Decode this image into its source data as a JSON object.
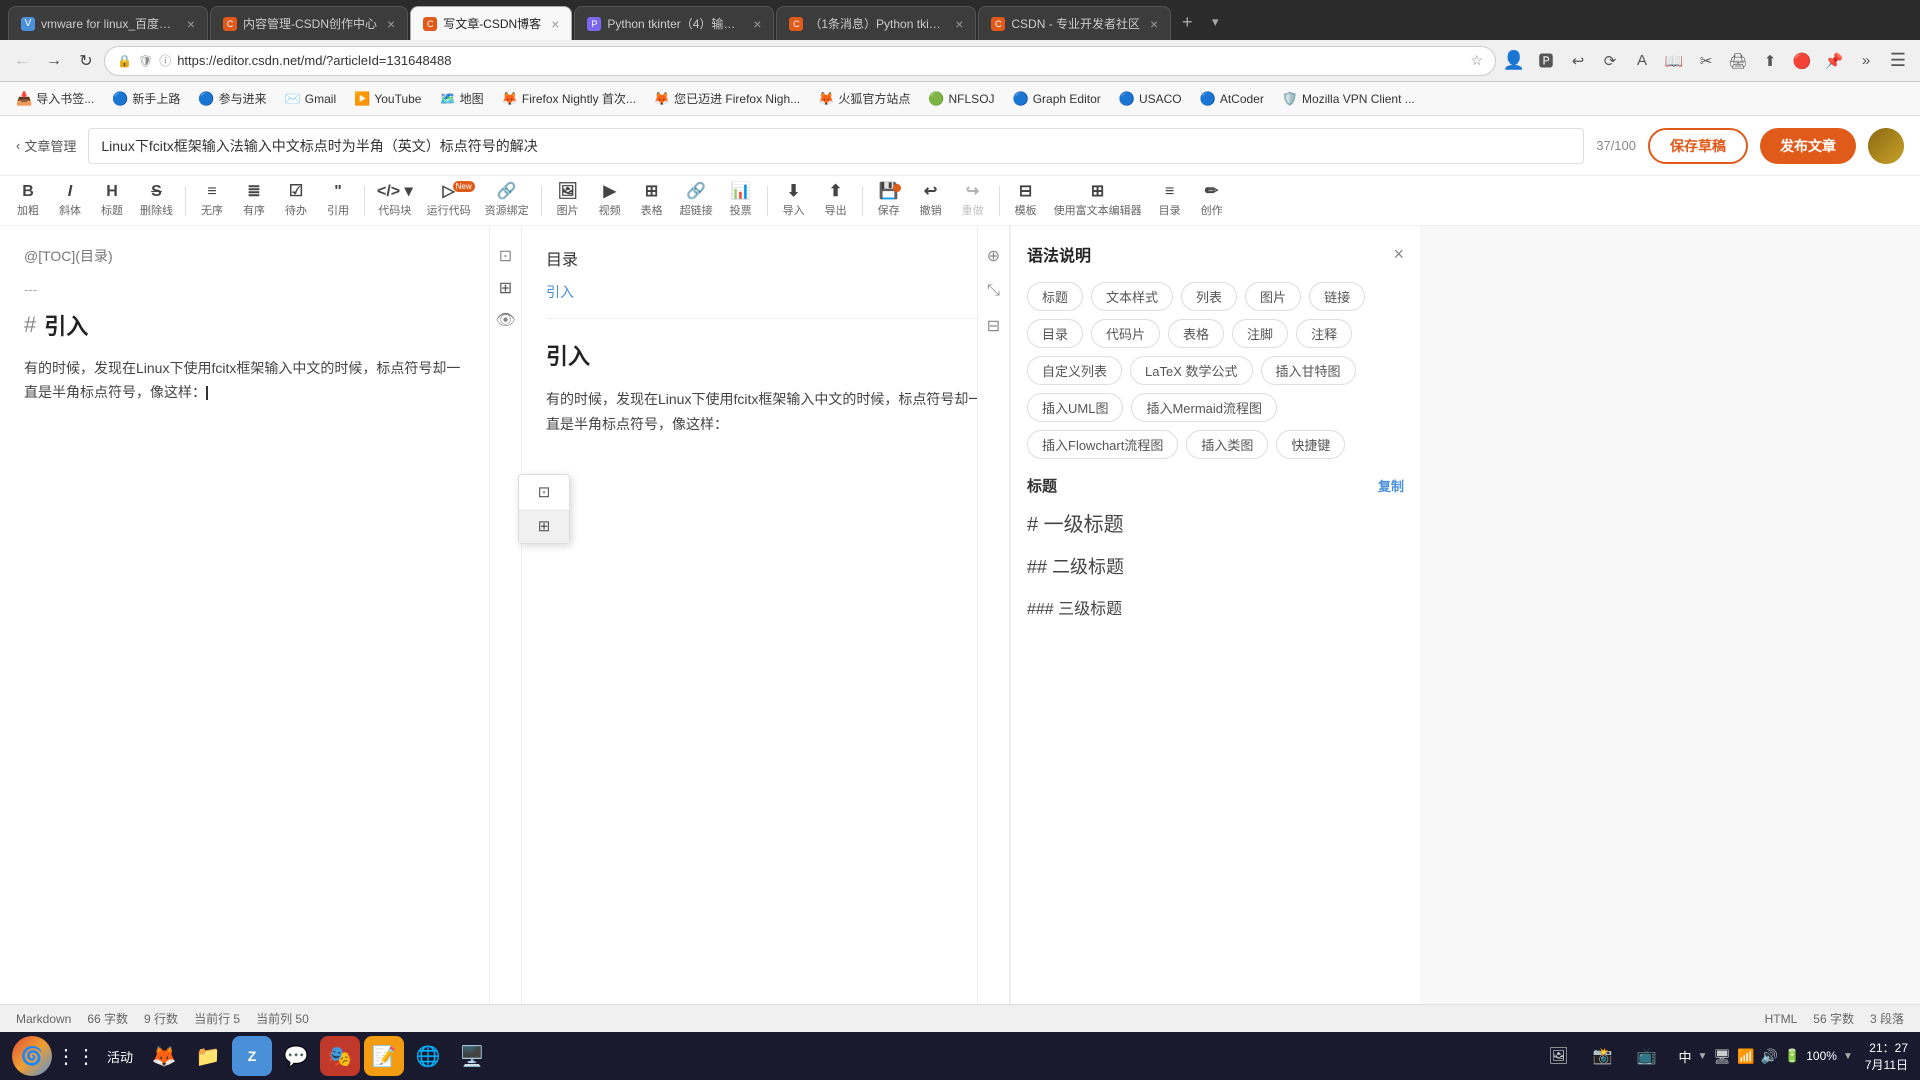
{
  "browser": {
    "tabs": [
      {
        "id": "tab1",
        "title": "vmware for linux_百度搜...",
        "favicon": "🔵",
        "active": false
      },
      {
        "id": "tab2",
        "title": "内容管理-CSDN创作中心",
        "favicon": "🟠",
        "active": false
      },
      {
        "id": "tab3",
        "title": "写文章-CSDN博客",
        "favicon": "🟠",
        "active": true
      },
      {
        "id": "tab4",
        "title": "Python tkinter（4）输入...",
        "favicon": "🟣",
        "active": false
      },
      {
        "id": "tab5",
        "title": "（1条消息）Python tkinter...",
        "favicon": "🟠",
        "active": false
      },
      {
        "id": "tab6",
        "title": "CSDN - 专业开发者社区",
        "favicon": "🟠",
        "active": false
      }
    ],
    "url": "https://editor.csdn.net/md/?articleId=131648488",
    "bookmarks": [
      {
        "label": "导入书签...",
        "icon": "📥"
      },
      {
        "label": "新手上路",
        "icon": "🔵"
      },
      {
        "label": "参与进来",
        "icon": "🔵"
      },
      {
        "label": "Gmail",
        "icon": "✉️"
      },
      {
        "label": "YouTube",
        "icon": "▶️"
      },
      {
        "label": "地图",
        "icon": "🗺️"
      },
      {
        "label": "Firefox Nightly 首次...",
        "icon": "🦊"
      },
      {
        "label": "您已迈进 Firefox Nigh...",
        "icon": "🦊"
      },
      {
        "label": "火狐官方站点",
        "icon": "🦊"
      },
      {
        "label": "NFLSOJ",
        "icon": "🟢"
      },
      {
        "label": "Graph Editor",
        "icon": "🔵"
      },
      {
        "label": "USACO",
        "icon": "🔵"
      },
      {
        "label": "AtCoder",
        "icon": "🔵"
      },
      {
        "label": "Mozilla VPN Client ...",
        "icon": "🛡️"
      }
    ]
  },
  "editor": {
    "article_title": "Linux下fcitx框架输入法输入中文标点时为半角（英文）标点符号的解决",
    "word_count": "37/100",
    "save_draft_label": "保存草稿",
    "publish_label": "发布文章",
    "toolbar": {
      "bold_label": "加粗",
      "italic_label": "斜体",
      "heading_label": "标题",
      "strikethrough_label": "删除线",
      "unordered_label": "无序",
      "ordered_label": "有序",
      "task_label": "待办",
      "quote_label": "引用",
      "code_block_label": "代码块",
      "run_code_label": "运行代码",
      "resource_bind_label": "资源绑定",
      "image_label": "图片",
      "video_label": "视频",
      "table_label": "表格",
      "hyperlink_label": "超链接",
      "poll_label": "投票",
      "import_label": "导入",
      "export_label": "导出",
      "save_label": "保存",
      "undo_label": "撤销",
      "redo_label": "重做",
      "template_label": "模板",
      "rich_editor_label": "使用富文本编辑器",
      "toc_label": "目录",
      "create_label": "创作"
    },
    "markdown_content": {
      "toc_text": "@[TOC](目录)",
      "hr": "---",
      "h1_hash": "#",
      "h1_text": "引入",
      "body_text": "有的时候，发现在Linux下使用fcitx框架输入中文的时候，标点符号却一直是半角标点符号，像这样："
    },
    "preview": {
      "toc_title": "目录",
      "toc_item": "引入",
      "h1_text": "引入",
      "body_text": "有的时候，发现在Linux下使用fcitx框架输入中文的时候，标点符号却一直是半角标点符号，像这样："
    },
    "syntax_panel": {
      "title": "语法说明",
      "tags": [
        "标题",
        "文本样式",
        "列表",
        "图片",
        "链接",
        "目录",
        "代码片",
        "表格",
        "注脚",
        "注释",
        "自定义列表",
        "LaTeX 数学公式",
        "插入甘特图",
        "插入UML图",
        "插入Mermaid流程图",
        "插入Flowchart流程图",
        "插入类图",
        "快捷键"
      ],
      "section_title": "标题",
      "copy_label": "复制",
      "items": [
        "# 一级标题",
        "## 二级标题",
        "### 三级标题"
      ]
    }
  },
  "status_bar": {
    "format": "Markdown",
    "char_count": "66 字数",
    "line_count": "9 行数",
    "current_row": "当前行 5",
    "current_col": "当前列 50",
    "html_label": "HTML",
    "html_chars": "56 字数",
    "html_sections": "3 段落"
  },
  "taskbar": {
    "apps": [
      {
        "icon": "🌀",
        "name": "zorin-menu"
      },
      {
        "icon": "⋮⋮",
        "name": "app-grid"
      },
      {
        "label": "活动",
        "name": "activities"
      },
      {
        "icon": "🦊",
        "name": "firefox"
      },
      {
        "icon": "📁",
        "name": "file-manager"
      },
      {
        "icon": "🔵",
        "name": "app2"
      },
      {
        "icon": "💬",
        "name": "wechat"
      },
      {
        "icon": "🎭",
        "name": "app3"
      },
      {
        "icon": "📝",
        "name": "app4"
      },
      {
        "icon": "🌐",
        "name": "app5"
      },
      {
        "icon": "🖥️",
        "name": "terminal"
      }
    ],
    "sys_tray": {
      "lang": "中",
      "ime_indicator": "▼",
      "network": "🔗",
      "audio": "🔊",
      "battery": "100%",
      "time": "21：27",
      "date": "7月11日"
    }
  },
  "dropdown_items": [
    {
      "icon": "⬜",
      "label": ""
    },
    {
      "icon": "⊞",
      "label": ""
    }
  ]
}
